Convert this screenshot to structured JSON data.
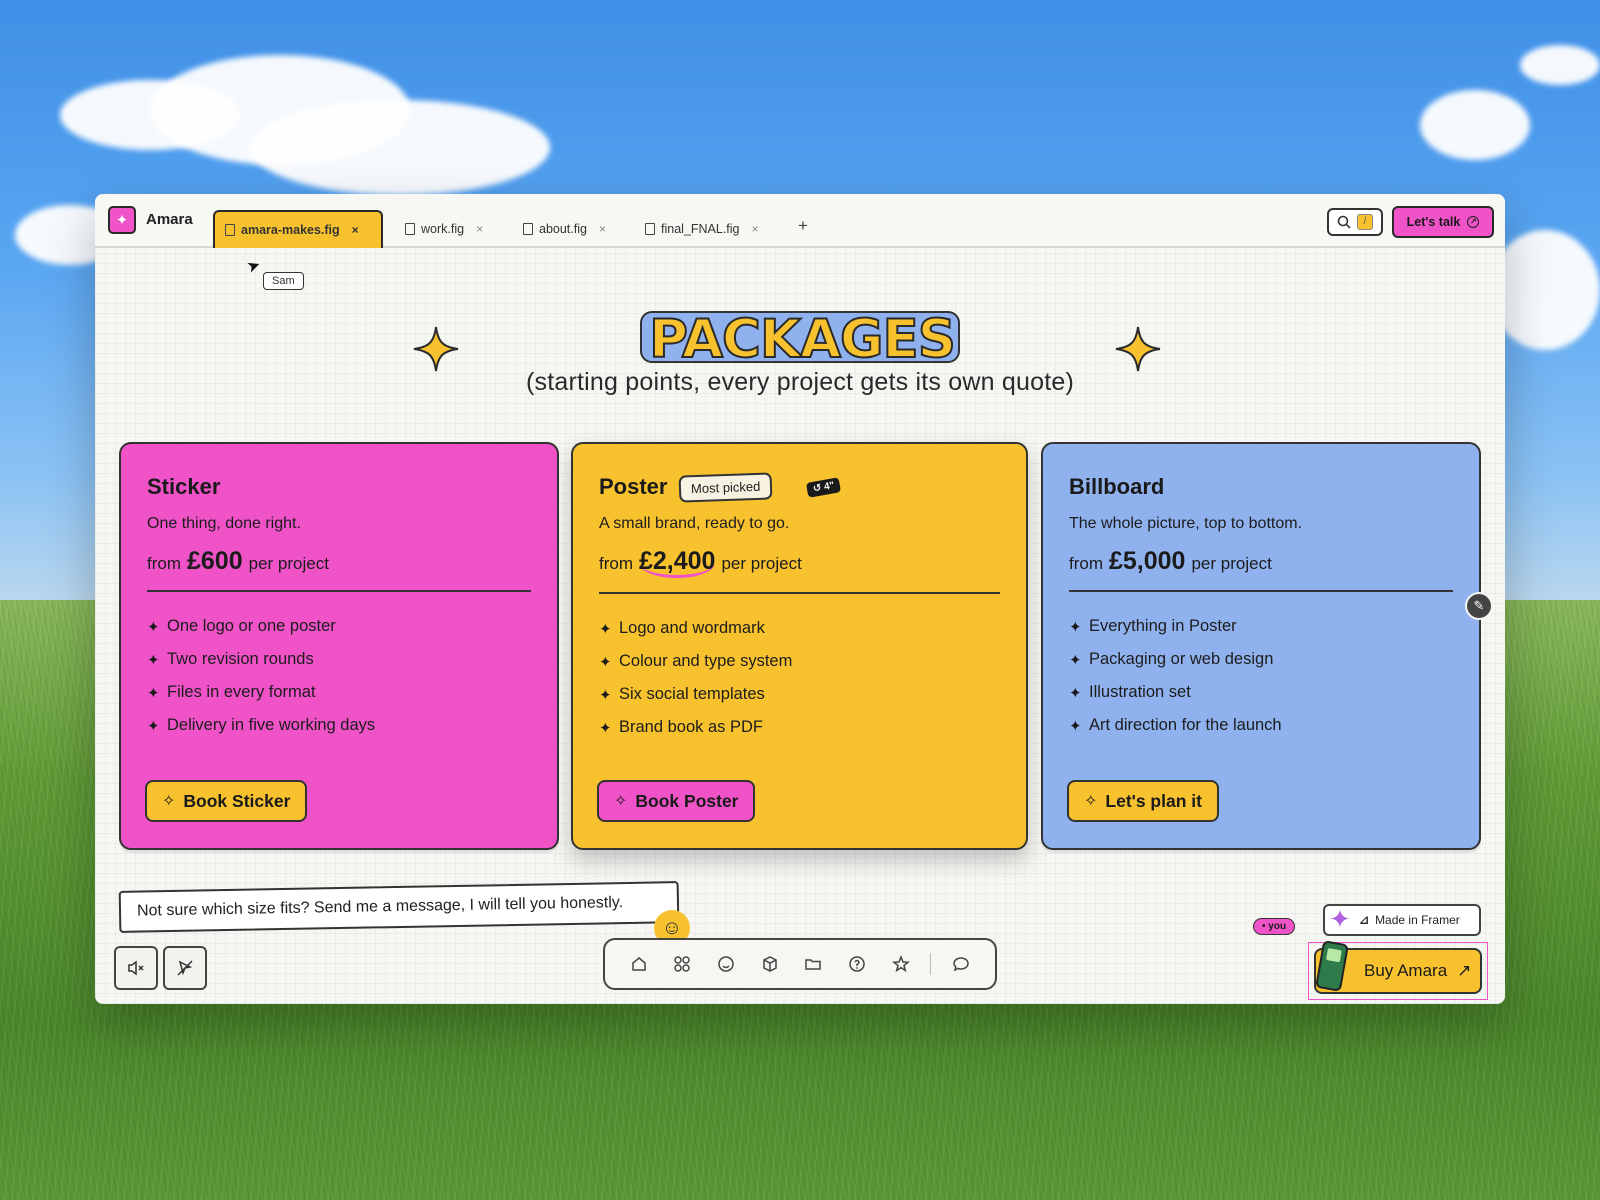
{
  "window": {
    "app_name": "Amara",
    "tabs": [
      {
        "label": "amara-makes.fig",
        "active": true
      },
      {
        "label": "work.fig",
        "active": false
      },
      {
        "label": "about.fig",
        "active": false
      },
      {
        "label": "final_FNAL.fig",
        "active": false
      }
    ],
    "tab_close": "×",
    "add_tab": "+",
    "search_shortcut": "/",
    "cta_label": "Let's talk"
  },
  "cursor": {
    "name": "Sam"
  },
  "heading": {
    "title": "PACKAGES",
    "subtitle": "(starting points, every project gets its own quote)"
  },
  "packages": [
    {
      "name": "Sticker",
      "tagline": "One thing, done right.",
      "price_prefix": "from",
      "price": "£600",
      "price_suffix": "per project",
      "features": [
        "One logo or one poster",
        "Two revision rounds",
        "Files in every format",
        "Delivery in five working days"
      ],
      "button": "Book Sticker",
      "color": "#f052c8"
    },
    {
      "name": "Poster",
      "badge": "Most picked",
      "chip": "↺ 4\"",
      "tagline": "A small brand, ready to go.",
      "price_prefix": "from",
      "price": "£2,400",
      "price_suffix": "per project",
      "features": [
        "Logo and wordmark",
        "Colour and type system",
        "Six social templates",
        "Brand book as PDF"
      ],
      "button": "Book Poster",
      "color": "#f7c22e"
    },
    {
      "name": "Billboard",
      "tagline": "The whole picture, top to bottom.",
      "price_prefix": "from",
      "price": "£5,000",
      "price_suffix": "per project",
      "features": [
        "Everything in Poster",
        "Packaging or web design",
        "Illustration set",
        "Art direction for the launch"
      ],
      "button": "Let's plan it",
      "color": "#8fb2ef"
    }
  ],
  "note": "Not sure which size fits? Send me a message, I will tell you honestly.",
  "you_tag": "• you",
  "made_in": "Made in Framer",
  "buy_label": "Buy Amara",
  "buy_arrow": "↗",
  "colors": {
    "pink": "#f052c8",
    "yellow": "#f7c22e",
    "blue": "#8fb2ef"
  }
}
